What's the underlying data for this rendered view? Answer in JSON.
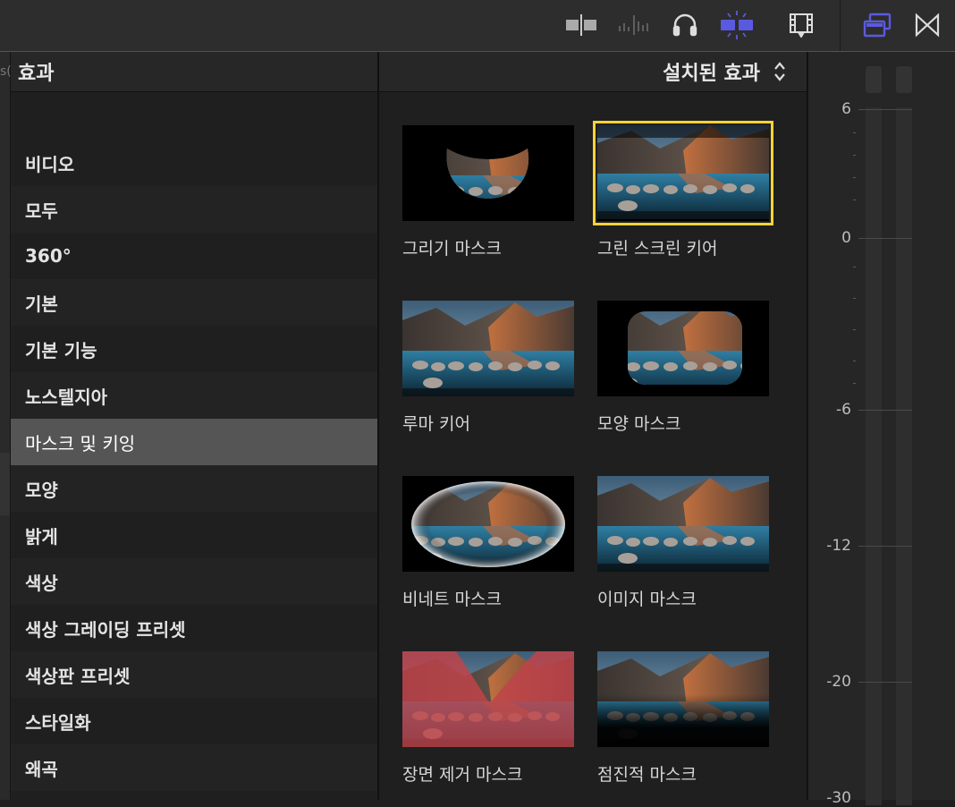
{
  "toolbar": {
    "icons": [
      "clip-skimming-icon",
      "audio-skimming-icon",
      "headphones-icon",
      "snapping-icon",
      "filmstrip-icon",
      "window-layout-icon",
      "transitions-icon"
    ],
    "accent": "#5a5ae0"
  },
  "left_panel": {
    "fragment": "s(",
    "title": "효과",
    "categories": [
      {
        "label": "비디오"
      },
      {
        "label": "모두"
      },
      {
        "label": "360°"
      },
      {
        "label": "기본"
      },
      {
        "label": "기본 기능"
      },
      {
        "label": "노스텔지아"
      },
      {
        "label": "마스크 및 키잉"
      },
      {
        "label": "모양"
      },
      {
        "label": "밝게"
      },
      {
        "label": "색상"
      },
      {
        "label": "색상 그레이딩 프리셋"
      },
      {
        "label": "색상판 프리셋"
      },
      {
        "label": "스타일화"
      },
      {
        "label": "왜곡"
      }
    ],
    "selected": "마스크 및 키잉"
  },
  "browser": {
    "sort_label": "설치된 효과",
    "effects": [
      {
        "label": "그리기 마스크"
      },
      {
        "label": "그린 스크린 키어"
      },
      {
        "label": "루마 키어"
      },
      {
        "label": "모양 마스크"
      },
      {
        "label": "비네트 마스크"
      },
      {
        "label": "이미지 마스크"
      },
      {
        "label": "장면 제거 마스크"
      },
      {
        "label": "점진적 마스크"
      }
    ],
    "selected": "그린 스크린 키어",
    "selection_color": "#f3d33a"
  },
  "meter": {
    "ticks": [
      "6",
      "0",
      "-6",
      "-12",
      "-20",
      "-30"
    ]
  }
}
